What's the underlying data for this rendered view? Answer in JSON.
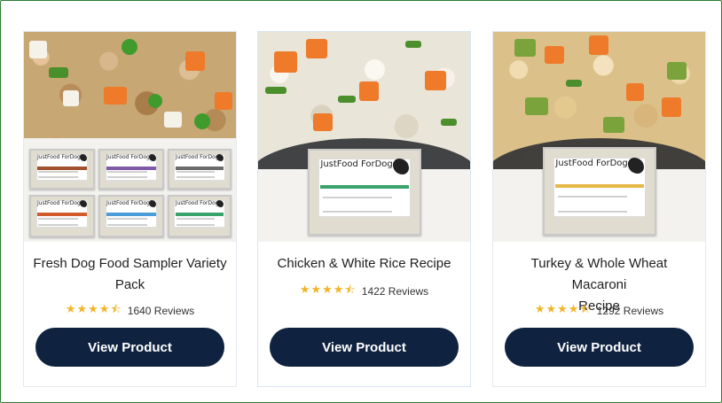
{
  "products": [
    {
      "title_line1": "Fresh Dog Food Sampler Variety",
      "title_line2": "Pack",
      "reviews_label": "1640 Reviews",
      "rating_stars": 4.5,
      "button_label": "View Product",
      "package_brand": "JustFood ForDogs"
    },
    {
      "title_line1": "Chicken & White Rice Recipe",
      "title_line2": "",
      "reviews_label": "1422 Reviews",
      "rating_stars": 4.5,
      "button_label": "View Product",
      "package_brand": "JustFood ForDogs"
    },
    {
      "title_line1": "Turkey & Whole Wheat Macaroni",
      "title_line2": "Recipe",
      "reviews_label": "1292 Reviews",
      "rating_stars": 4.5,
      "button_label": "View Product",
      "package_brand": "JustFood ForDogs"
    }
  ],
  "colors": {
    "button": "#0f2340",
    "star": "#f0b529",
    "frame_border": "#2e7d32"
  },
  "star_glyphs": "★★★★⯪"
}
